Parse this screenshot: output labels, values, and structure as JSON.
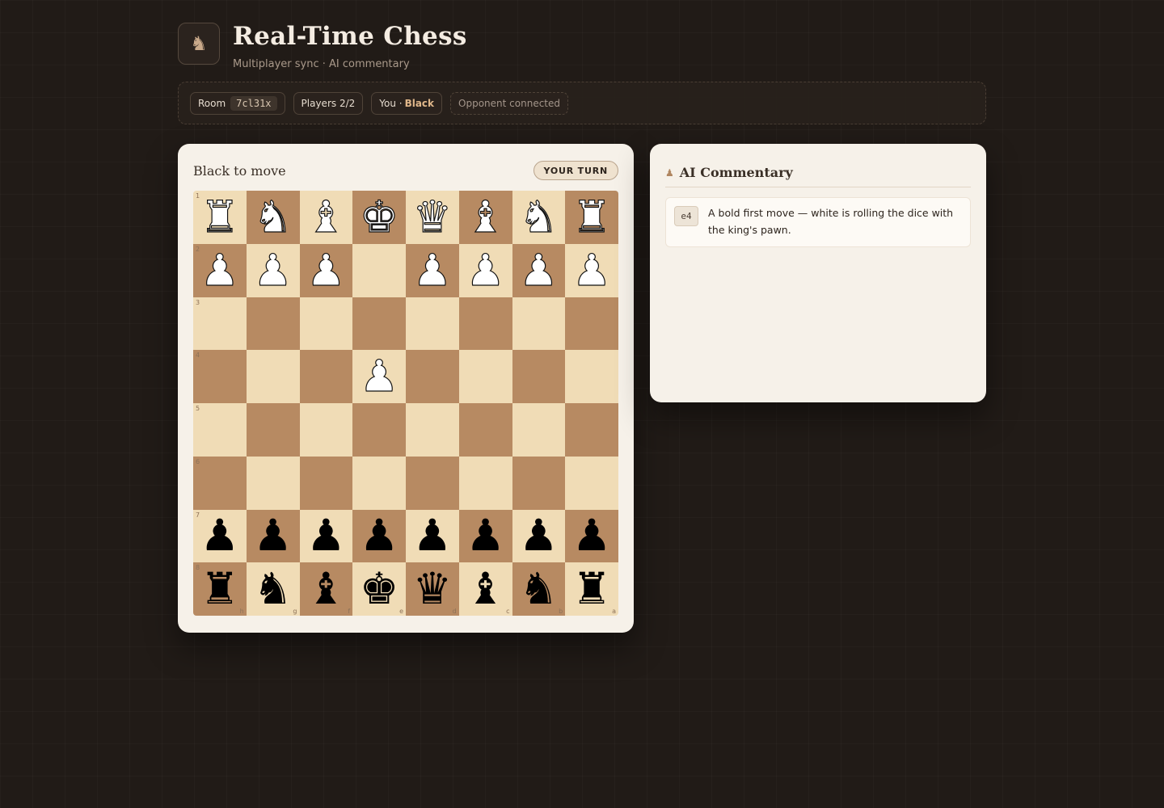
{
  "header": {
    "logo_icon": "♞",
    "title": "Real-Time Chess",
    "subtitle": "Multiplayer sync · AI commentary"
  },
  "status": {
    "room_label": "Room",
    "room_code": "7cl31x",
    "players": "Players 2/2",
    "you_label": "You ·",
    "you_color": "Black",
    "connection": "Opponent connected"
  },
  "game": {
    "turn_text": "Black to move",
    "turn_badge": "YOUR TURN",
    "orientation": "black",
    "rank_labels": [
      "1",
      "2",
      "3",
      "4",
      "5",
      "6",
      "7",
      "8"
    ],
    "file_labels": [
      "h",
      "g",
      "f",
      "e",
      "d",
      "c",
      "b",
      "a"
    ],
    "board": [
      [
        "wR",
        "wN",
        "wB",
        "wK",
        "wQ",
        "wB",
        "wN",
        "wR"
      ],
      [
        "wP",
        "wP",
        "wP",
        "",
        "wP",
        "wP",
        "wP",
        "wP"
      ],
      [
        "",
        "",
        "",
        "",
        "",
        "",
        "",
        ""
      ],
      [
        "",
        "",
        "",
        "wP",
        "",
        "",
        "",
        ""
      ],
      [
        "",
        "",
        "",
        "",
        "",
        "",
        "",
        ""
      ],
      [
        "",
        "",
        "",
        "",
        "",
        "",
        "",
        ""
      ],
      [
        "bP",
        "bP",
        "bP",
        "bP",
        "bP",
        "bP",
        "bP",
        "bP"
      ],
      [
        "bR",
        "bN",
        "bB",
        "bK",
        "bQ",
        "bB",
        "bN",
        "bR"
      ]
    ]
  },
  "commentary": {
    "icon": "♟",
    "title": "AI Commentary",
    "entries": [
      {
        "move": "e4",
        "text": "A bold first move — white is rolling the dice with the king's pawn."
      }
    ]
  },
  "colors": {
    "light_square": "#f0dcb6",
    "dark_square": "#b78a62",
    "accent": "#e0b78a",
    "background": "#211b17"
  }
}
